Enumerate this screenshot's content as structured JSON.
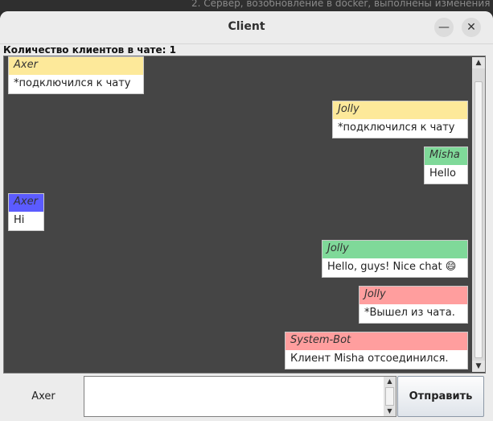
{
  "background_text": "2. Сервер, возобновление в docker, выполнены изменения",
  "window": {
    "title": "Client",
    "minimize_glyph": "—",
    "close_glyph": "✕"
  },
  "header": {
    "clients_count_label": "Количество клиентов в чате: 1"
  },
  "messages": [
    {
      "sender": "Axer",
      "text": "*подключился к чату",
      "align": "left",
      "color": "#fde99a"
    },
    {
      "sender": "Jolly",
      "text": "*подключился к чату",
      "align": "right",
      "color": "#fde99a"
    },
    {
      "sender": "Misha",
      "text": "Hello",
      "align": "right",
      "color": "#7fd999"
    },
    {
      "sender": "Axer",
      "text": "Hi",
      "align": "left",
      "color": "#5b5bff"
    },
    {
      "sender": "Jolly",
      "text": "Hello, guys! Nice chat 😄",
      "align": "right",
      "color": "#7fd999"
    },
    {
      "sender": "Jolly",
      "text": "*Вышел из чата.",
      "align": "right",
      "color": "#ff9e9e"
    },
    {
      "sender": "System-Bot",
      "text": "Клиент Misha отсоединился.",
      "align": "right",
      "color": "#ff9e9e"
    }
  ],
  "composer": {
    "user_name": "Axer",
    "input_value": "",
    "send_label": "Отправить"
  },
  "icons": {
    "scroll_up": "scroll-up-arrow-icon",
    "scroll_down": "scroll-down-arrow-icon",
    "minimize": "minimize-icon",
    "close": "close-icon"
  }
}
